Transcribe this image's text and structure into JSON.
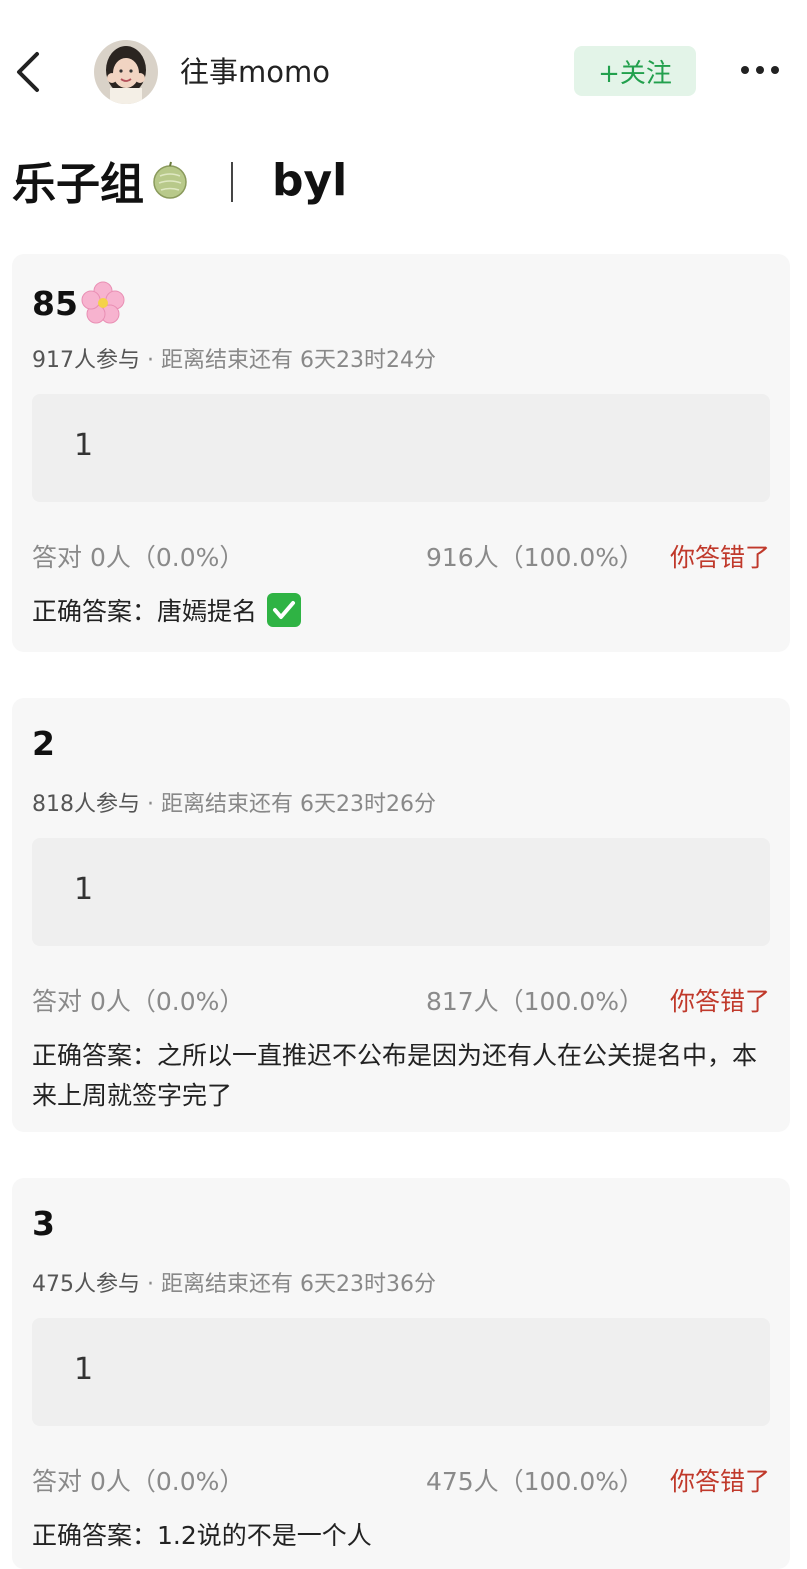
{
  "header": {
    "username": "往事momo",
    "follow_label": "+关注"
  },
  "title": {
    "left": "乐子组",
    "separator": "｜",
    "right": "byl"
  },
  "cards": [
    {
      "title": "85",
      "participants": "917人参与",
      "dot": " · ",
      "countdown": "距离结束还有 6天23时24分",
      "option": "1",
      "correct_stats": "答对  0人（0.0%）",
      "other_count": "916人（100.0%）",
      "result": "你答错了",
      "answer": "正确答案：唐嫣提名"
    },
    {
      "title": "2",
      "participants": "818人参与",
      "dot": " · ",
      "countdown": "距离结束还有 6天23时26分",
      "option": "1",
      "correct_stats": "答对  0人（0.0%）",
      "other_count": "817人（100.0%）",
      "result": "你答错了",
      "answer": "正确答案：之所以一直推迟不公布是因为还有人在公关提名中，本来上周就签字完了"
    },
    {
      "title": "3",
      "participants": "475人参与",
      "dot": " · ",
      "countdown": "距离结束还有 6天23时36分",
      "option": "1",
      "correct_stats": "答对  0人（0.0%）",
      "other_count": "475人（100.0%）",
      "result": "你答错了",
      "answer": "正确答案：1.2说的不是一个人"
    }
  ],
  "colors": {
    "follow_bg": "#e3f4e8",
    "follow_text": "#22a04d",
    "wrong_text": "#c0392b",
    "card_bg": "#f7f7f7",
    "option_bg": "#efefef"
  },
  "icons": [
    "back-arrow-icon",
    "avatar",
    "more-icon",
    "melon-icon",
    "flower-icon",
    "check-icon"
  ]
}
